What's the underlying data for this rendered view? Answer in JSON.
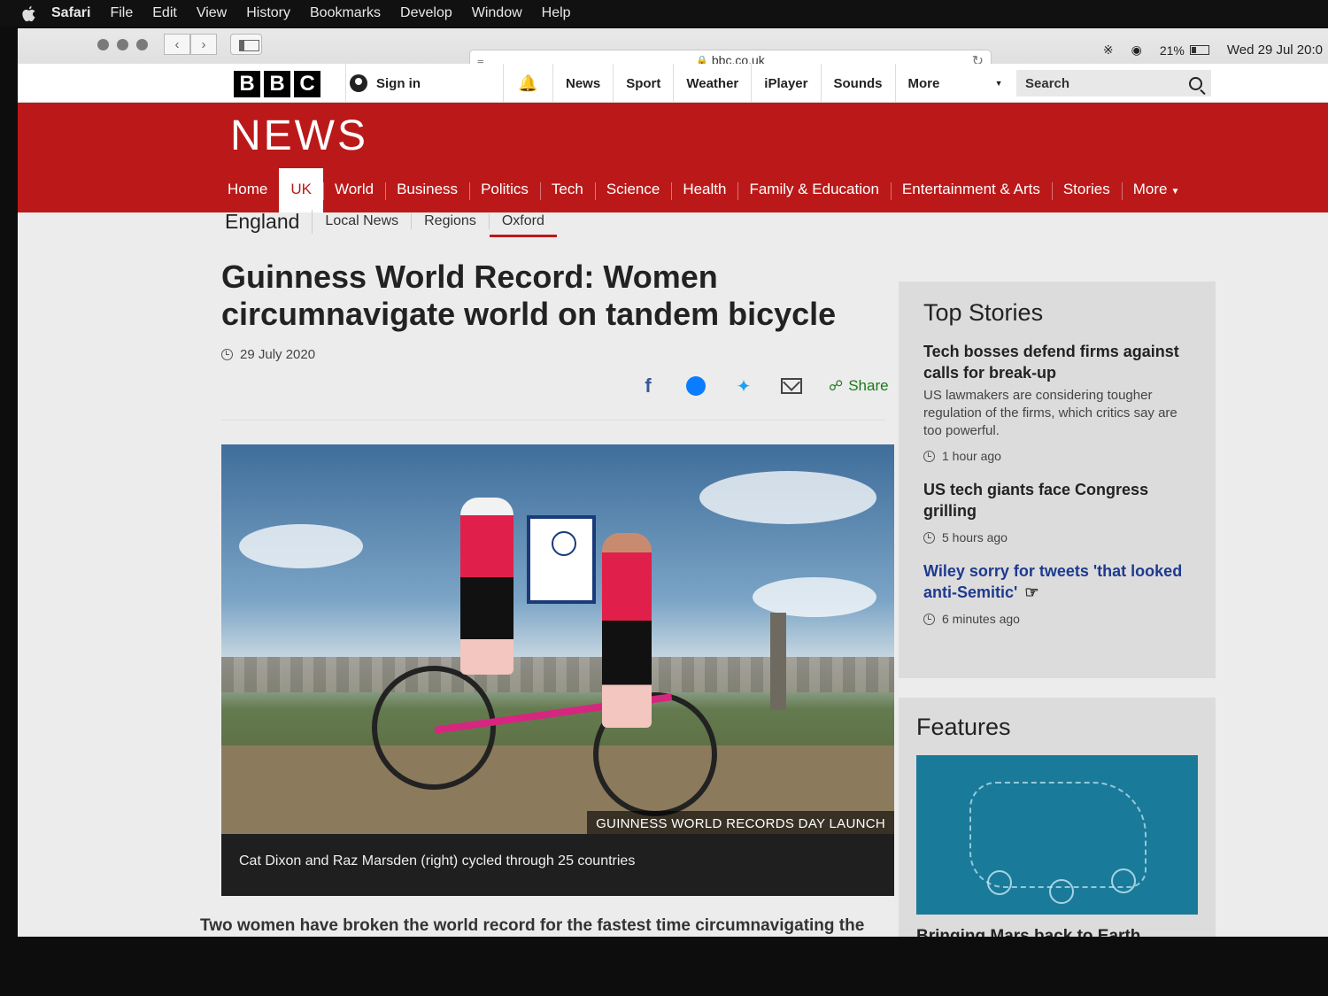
{
  "menubar": {
    "app": "Safari",
    "items": [
      "File",
      "Edit",
      "View",
      "History",
      "Bookmarks",
      "Develop",
      "Window",
      "Help"
    ]
  },
  "browser": {
    "url": "bbc.co.uk",
    "battery": "21%",
    "datetime": "Wed 29 Jul  20:0"
  },
  "bbc_bar": {
    "logo_letters": [
      "B",
      "B",
      "C"
    ],
    "sign_in": "Sign in",
    "nav": [
      "News",
      "Sport",
      "Weather",
      "iPlayer",
      "Sounds"
    ],
    "more": "More",
    "search_placeholder": "Search"
  },
  "news": {
    "logo": "NEWS",
    "sections": [
      "Home",
      "UK",
      "World",
      "Business",
      "Politics",
      "Tech",
      "Science",
      "Health",
      "Family & Education",
      "Entertainment & Arts",
      "Stories"
    ],
    "sections_more": "More",
    "active_section": "UK"
  },
  "subnav": {
    "region": "England",
    "items": [
      "Local News",
      "Regions"
    ],
    "current": "Oxford"
  },
  "article": {
    "headline": "Guinness World Record: Women circumnavigate world on tandem bicycle",
    "date": "29 July 2020",
    "share_label": "Share",
    "image_credit": "GUINNESS WORLD RECORDS DAY LAUNCH",
    "caption": "Cat Dixon and Raz Marsden (right) cycled through 25 countries",
    "intro": "Two women have broken the world record for the fastest time circumnavigating the globe on a tandem bicycle."
  },
  "top_stories": {
    "title": "Top Stories",
    "stories": [
      {
        "title": "Tech bosses defend firms against calls for break-up",
        "desc": "US lawmakers are considering tougher regulation of the firms, which critics say are too powerful.",
        "time": "1 hour ago"
      },
      {
        "title": "US tech giants face Congress grilling",
        "time": "5 hours ago"
      },
      {
        "title": "Wiley sorry for tweets 'that looked anti-Semitic'",
        "time": "6 minutes ago"
      }
    ]
  },
  "features": {
    "title": "Features",
    "item_title": "Bringing Mars back to Earth"
  },
  "icons": [
    "apple-icon",
    "back-icon",
    "forward-icon",
    "sidebar-icon",
    "lock-icon",
    "reload-icon",
    "wifi-icon",
    "bluetooth-icon",
    "battery-icon",
    "user-icon",
    "bell-icon",
    "search-icon",
    "facebook-icon",
    "messenger-icon",
    "twitter-icon",
    "email-icon",
    "share-icon",
    "clock-icon",
    "hand-cursor-icon"
  ],
  "colors": {
    "bbc_red": "#bb1919",
    "link_blue": "#1d3a8f",
    "share_green": "#1a7a1a"
  }
}
